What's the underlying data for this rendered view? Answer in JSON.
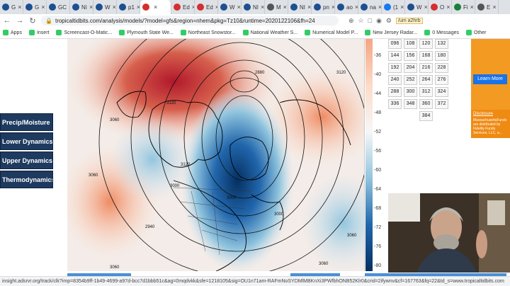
{
  "tabs": [
    {
      "label": "G",
      "icon": "noaa-icon"
    },
    {
      "label": "G",
      "icon": "noaa-icon"
    },
    {
      "label": "GC",
      "icon": "noaa-icon"
    },
    {
      "label": "Nì",
      "icon": "noaa-icon"
    },
    {
      "label": "W",
      "icon": "noaa-icon"
    },
    {
      "label": "p1",
      "icon": "noaa-icon"
    },
    {
      "label": "",
      "icon": "tropicaltidbits-icon",
      "active": true
    },
    {
      "label": "Ed",
      "icon": "tropicaltidbits-icon"
    },
    {
      "label": "Ed",
      "icon": "tropicaltidbits-icon"
    },
    {
      "label": "W",
      "icon": "noaa-icon"
    },
    {
      "label": "NI",
      "icon": "noaa-icon"
    },
    {
      "label": "M",
      "icon": "gear-icon"
    },
    {
      "label": "NI",
      "icon": "noaa-icon"
    },
    {
      "label": "pn",
      "icon": "noaa-icon"
    },
    {
      "label": "ao",
      "icon": "noaa-icon"
    },
    {
      "label": "na",
      "icon": "noaa-icon"
    },
    {
      "label": "(1",
      "icon": "facebook-icon"
    },
    {
      "label": "W",
      "icon": "noaa-icon"
    },
    {
      "label": "O",
      "icon": "red-icon"
    },
    {
      "label": "Fi",
      "icon": "green-icon"
    },
    {
      "label": "E",
      "icon": "gray-icon"
    }
  ],
  "toolbar": {
    "url": "tropicaltidbits.com/analysis/models/?model=gfs&region=nhem&pkg=Tz10&runtime=2020122106&fh=24",
    "extension_badge": "/um a2hrb"
  },
  "bookmarks": [
    {
      "label": "Apps"
    },
    {
      "label": "Insert"
    },
    {
      "label": "Screencast-O-Matic..."
    },
    {
      "label": "Plymouth State We..."
    },
    {
      "label": "Northeast Snowstor..."
    },
    {
      "label": "National Weather S..."
    },
    {
      "label": "Numerical Model P..."
    },
    {
      "label": "New Jersey Radar..."
    },
    {
      "label": "0 Messages"
    },
    {
      "label": "Other"
    }
  ],
  "side_buttons": [
    "Precip/Moisture",
    "Lower Dynamics",
    "Upper Dynamics",
    "Thermodynamics"
  ],
  "forecast_hours": [
    "096",
    "108",
    "120",
    "132",
    "144",
    "156",
    "168",
    "180",
    "192",
    "204",
    "216",
    "228",
    "240",
    "252",
    "264",
    "276",
    "288",
    "300",
    "312",
    "324",
    "336",
    "348",
    "360",
    "372",
    "384"
  ],
  "colorbar_ticks": [
    "-36",
    "-40",
    "-44",
    "-48",
    "-52",
    "-56",
    "-60",
    "-64",
    "-68",
    "-72",
    "-76",
    "-80"
  ],
  "map_labels": [
    "3120",
    "3120",
    "3060",
    "3060",
    "3000",
    "3000",
    "2940",
    "2880",
    "3000",
    "3060",
    "3120",
    "3060",
    "3060"
  ],
  "ad": {
    "button": "Learn More",
    "disclosure": "Disclosure",
    "text": "MassachusettsFunds are distributed by Fidelity Funds Services, LLC, a..."
  },
  "statusbar": "insight.adsrvr.org/track/clk?imp=8354b9ff-1b49-4699-a97d-bcc7d1bbb51c&ag=0mqdvkk&sfe=1218105&sig=OU1n71am-RAFmNoSYDMlMBKnXi3PWfbhONB52Klr0&crid=2ifywnv&cf=167763&fq=22&td_s=www.tropicaltidbits.com",
  "colors": {
    "warm": "#d6604d",
    "cold": "#2166ac",
    "button_bg": "#1e3a5f",
    "ad_bg": "#f29a22"
  }
}
